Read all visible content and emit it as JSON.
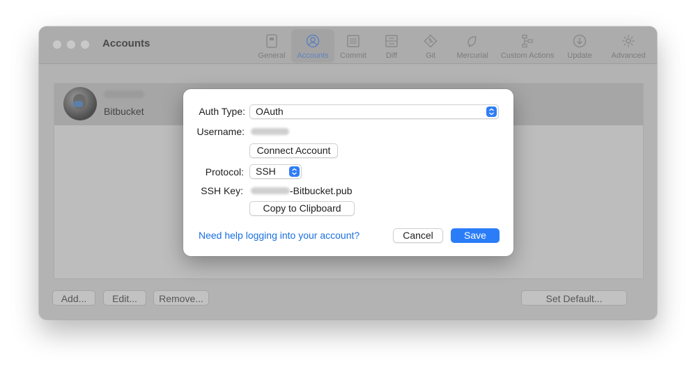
{
  "window": {
    "title": "Accounts",
    "tabs": [
      {
        "label": "General",
        "icon": "general-icon"
      },
      {
        "label": "Accounts",
        "icon": "accounts-icon",
        "active": true
      },
      {
        "label": "Commit",
        "icon": "commit-icon"
      },
      {
        "label": "Diff",
        "icon": "diff-icon"
      },
      {
        "label": "Git",
        "icon": "git-icon"
      },
      {
        "label": "Mercurial",
        "icon": "mercurial-icon"
      },
      {
        "label": "Custom Actions",
        "icon": "custom-actions-icon"
      },
      {
        "label": "Update",
        "icon": "update-icon"
      },
      {
        "label": "Advanced",
        "icon": "gear-icon"
      }
    ]
  },
  "accounts": [
    {
      "service": "Bitbucket",
      "selected": true
    }
  ],
  "footer": {
    "add_label": "Add...",
    "edit_label": "Edit...",
    "remove_label": "Remove...",
    "set_default_label": "Set Default..."
  },
  "dialog": {
    "auth_type_label": "Auth Type:",
    "auth_type_value": "OAuth",
    "username_label": "Username:",
    "connect_label": "Connect Account",
    "protocol_label": "Protocol:",
    "protocol_value": "SSH",
    "ssh_key_label": "SSH Key:",
    "ssh_key_suffix": "-Bitbucket.pub",
    "copy_label": "Copy to Clipboard",
    "help_link": "Need help logging into your account?",
    "cancel_label": "Cancel",
    "save_label": "Save"
  },
  "colors": {
    "accent": "#2b7df7",
    "link": "#1a6fe0",
    "dimmed_window": "#b3b3b3"
  }
}
